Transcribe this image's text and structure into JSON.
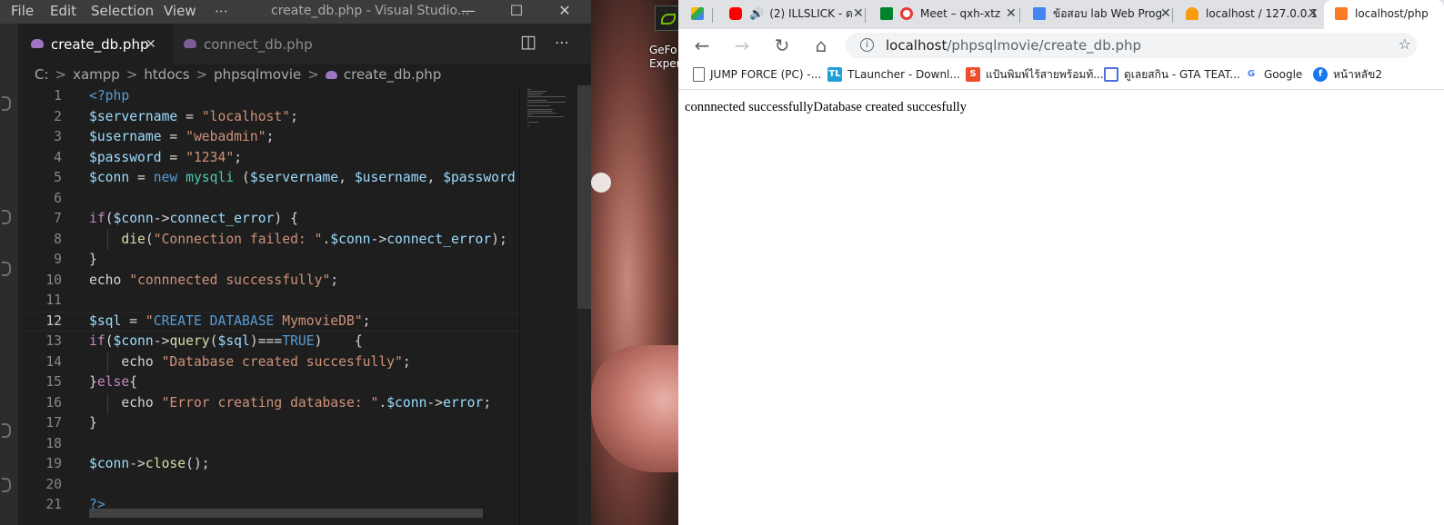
{
  "vscode": {
    "menu": [
      "File",
      "Edit",
      "Selection",
      "View",
      "⋯"
    ],
    "window_title": "create_db.php - Visual Studio...",
    "window_controls": {
      "minimize": "—",
      "maximize": "☐",
      "close": "✕"
    },
    "tabs": [
      {
        "label": "create_db.php",
        "active": true,
        "close": "✕"
      },
      {
        "label": "connect_db.php",
        "active": false
      }
    ],
    "tab_actions": {
      "split": "◫",
      "more": "⋯"
    },
    "breadcrumb": [
      "C:",
      "xampp",
      "htdocs",
      "phpsqlmovie",
      "create_db.php"
    ],
    "breadcrumb_sep": ">",
    "line_numbers": [
      "1",
      "2",
      "3",
      "4",
      "5",
      "6",
      "7",
      "8",
      "9",
      "10",
      "11",
      "12",
      "13",
      "14",
      "15",
      "16",
      "17",
      "18",
      "19",
      "20",
      "21"
    ],
    "code": [
      [
        [
          "k-tag",
          "<"
        ],
        [
          "k-tag",
          "?php"
        ]
      ],
      [
        [
          "k-var",
          "$servername"
        ],
        [
          "k-p",
          " = "
        ],
        [
          "k-str",
          "\"localhost\""
        ],
        [
          "k-p",
          ";"
        ]
      ],
      [
        [
          "k-var",
          "$username"
        ],
        [
          "k-p",
          " = "
        ],
        [
          "k-str",
          "\"webadmin\""
        ],
        [
          "k-p",
          ";"
        ]
      ],
      [
        [
          "k-var",
          "$password"
        ],
        [
          "k-p",
          " = "
        ],
        [
          "k-str",
          "\"1234\""
        ],
        [
          "k-p",
          ";"
        ]
      ],
      [
        [
          "k-var",
          "$conn"
        ],
        [
          "k-p",
          " = "
        ],
        [
          "k-kw",
          "new"
        ],
        [
          "k-p",
          " "
        ],
        [
          "k-cls",
          "mysqli"
        ],
        [
          "k-p",
          " ("
        ],
        [
          "k-var",
          "$servername"
        ],
        [
          "k-p",
          ", "
        ],
        [
          "k-var",
          "$username"
        ],
        [
          "k-p",
          ", "
        ],
        [
          "k-var",
          "$password"
        ]
      ],
      [],
      [
        [
          "k-ctl",
          "if"
        ],
        [
          "k-p",
          "("
        ],
        [
          "k-var",
          "$conn"
        ],
        [
          "k-p",
          "->"
        ],
        [
          "k-var",
          "connect_error"
        ],
        [
          "k-p",
          ") {"
        ]
      ],
      [
        [
          "k-p",
          "    "
        ],
        [
          "k-fn",
          "die"
        ],
        [
          "k-p",
          "("
        ],
        [
          "k-str",
          "\"Connection failed: \""
        ],
        [
          "k-p",
          "."
        ],
        [
          "k-var",
          "$conn"
        ],
        [
          "k-p",
          "->"
        ],
        [
          "k-var",
          "connect_error"
        ],
        [
          "k-p",
          ");"
        ]
      ],
      [
        [
          "k-p",
          "}"
        ]
      ],
      [
        [
          "k-p",
          "echo "
        ],
        [
          "k-str",
          "\"connnected successfully\""
        ],
        [
          "k-p",
          ";"
        ]
      ],
      [],
      [
        [
          "k-var",
          "$sql"
        ],
        [
          "k-p",
          " = "
        ],
        [
          "k-str",
          "\""
        ],
        [
          "k-kw",
          "CREATE DATABASE"
        ],
        [
          "k-str",
          " MymovieDB\""
        ],
        [
          "k-p",
          ";"
        ]
      ],
      [
        [
          "k-ctl",
          "if"
        ],
        [
          "k-p",
          "("
        ],
        [
          "k-var",
          "$conn"
        ],
        [
          "k-p",
          "->"
        ],
        [
          "k-fn",
          "query"
        ],
        [
          "k-p",
          "("
        ],
        [
          "k-var",
          "$sql"
        ],
        [
          "k-p",
          ")==="
        ],
        [
          "k-kw",
          "TRUE"
        ],
        [
          "k-p",
          ")    {"
        ]
      ],
      [
        [
          "k-p",
          "    echo "
        ],
        [
          "k-str",
          "\"Database created succesfully\""
        ],
        [
          "k-p",
          ";"
        ]
      ],
      [
        [
          "k-p",
          "}"
        ],
        [
          "k-ctl",
          "else"
        ],
        [
          "k-p",
          "{"
        ]
      ],
      [
        [
          "k-p",
          "    echo "
        ],
        [
          "k-str",
          "\"Error creating database: \""
        ],
        [
          "k-p",
          "."
        ],
        [
          "k-var",
          "$conn"
        ],
        [
          "k-p",
          "->"
        ],
        [
          "k-var",
          "error"
        ],
        [
          "k-p",
          ";"
        ]
      ],
      [
        [
          "k-p",
          "}"
        ]
      ],
      [],
      [
        [
          "k-var",
          "$conn"
        ],
        [
          "k-p",
          "->"
        ],
        [
          "k-fn",
          "close"
        ],
        [
          "k-p",
          "();"
        ]
      ],
      [],
      [
        [
          "k-tag",
          "?>"
        ]
      ]
    ],
    "active_line": 12
  },
  "desktop": {
    "shortcut_label": [
      "GeFo",
      "Experi"
    ]
  },
  "browser": {
    "tabs": [
      {
        "title": "",
        "icon_color": "#34a853",
        "icon": "drive-icon"
      },
      {
        "title": "(2) ILLSLICK - ด",
        "icon_color": "#ff0000",
        "icon": "youtube-icon",
        "muted": "🔊"
      },
      {
        "title": "Meet – qxh-xtz",
        "icon_color": "#00832d",
        "icon": "meet-icon"
      },
      {
        "title": "ข้อสอบ lab Web Prog",
        "icon_color": "#4285f4",
        "icon": "docs-icon"
      },
      {
        "title": "localhost / 127.0.0.1",
        "icon_color": "#f89c0e",
        "icon": "phpmyadmin-icon"
      },
      {
        "title": "localhost/php",
        "icon_color": "#fb7a24",
        "icon": "xampp-icon"
      }
    ],
    "tab_close": "✕",
    "nav": {
      "back": "←",
      "forward": "→",
      "reload": "↻",
      "home": "⌂"
    },
    "url_host": "localhost",
    "url_path": "/phpsqlmovie/create_db.php",
    "omni_info": "i",
    "omni_star": "☆",
    "bookmarks": [
      {
        "label": "JUMP FORCE (PC) -...",
        "icon": "page-icon",
        "icon_color": "#ffffff",
        "icon_text": ""
      },
      {
        "label": "TLauncher - Downl...",
        "icon": "tlauncher-icon",
        "icon_color": "#1fa1d8",
        "icon_text": "TL"
      },
      {
        "label": "แป้นพิมพ์ไร้สายพร้อมท้...",
        "icon": "shopee-icon",
        "icon_color": "#ee4d2d",
        "icon_text": "S"
      },
      {
        "label": "ดูเลยสกิน - GTA TEAT...",
        "icon": "web-icon",
        "icon_color": "#4a6ee0",
        "icon_text": ""
      },
      {
        "label": "Google",
        "icon": "google-icon",
        "icon_color": "#ffffff",
        "icon_text": "G"
      },
      {
        "label": "หน้าหลัข2",
        "icon": "facebook-icon",
        "icon_color": "#1877f2",
        "icon_text": "f"
      }
    ],
    "page_text": "connnected successfullyDatabase created succesfully"
  }
}
